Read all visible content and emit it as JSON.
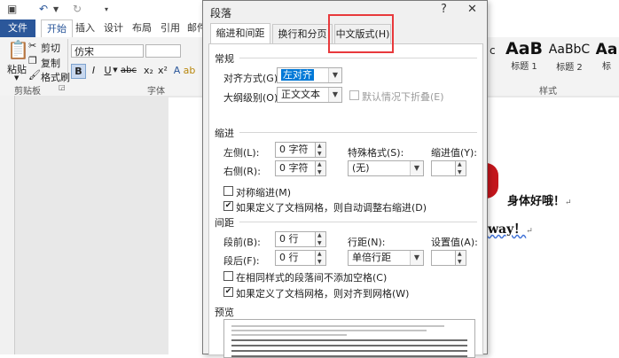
{
  "ribbon": {
    "tabs": [
      "文件",
      "开始",
      "插入",
      "设计",
      "布局",
      "引用",
      "邮件"
    ],
    "clipboard": {
      "paste": "粘贴",
      "cut": "剪切",
      "copy": "复制",
      "format_painter": "格式刷"
    },
    "font_name": "仿宋",
    "format_buttons": [
      "B",
      "I",
      "U",
      "abc",
      "x₂",
      "x²"
    ],
    "group_labels": {
      "clipboard": "剪贴板",
      "font": "字体",
      "styles": "样式"
    },
    "styles": [
      {
        "sample": "AaB",
        "name": "标题 1"
      },
      {
        "sample": "AaBbC",
        "name": "标题 2"
      },
      {
        "sample": "Aa",
        "name": "标"
      }
    ]
  },
  "document": {
    "line1": "身体好哦！",
    "line2": "way！",
    "paragraph_mark": "↵"
  },
  "dialog": {
    "title": "段落",
    "help_icon": "?",
    "close_icon": "✕",
    "tabs": [
      "缩进和间距(I)",
      "换行和分页(P)",
      "中文版式(H)"
    ],
    "general": {
      "heading": "常规",
      "alignment_label": "对齐方式(G):",
      "alignment_value": "左对齐",
      "outline_label": "大纲级别(O):",
      "outline_value": "正文文本",
      "collapse_label": "默认情况下折叠(E)"
    },
    "indent": {
      "heading": "缩进",
      "left_label": "左侧(L):",
      "left_value": "0 字符",
      "right_label": "右侧(R):",
      "right_value": "0 字符",
      "special_label": "特殊格式(S):",
      "special_value": "(无)",
      "value_label": "缩进值(Y):",
      "mirror_label": "对称缩进(M)",
      "auto_adjust_label": "如果定义了文档网格，则自动调整右缩进(D)"
    },
    "spacing": {
      "heading": "间距",
      "before_label": "段前(B):",
      "before_value": "0 行",
      "after_label": "段后(F):",
      "after_value": "0 行",
      "line_label": "行距(N):",
      "line_value": "单倍行距",
      "setting_label": "设置值(A):",
      "no_space_label": "在相同样式的段落间不添加空格(C)",
      "snap_grid_label": "如果定义了文档网格，则对齐到网格(W)"
    },
    "preview_heading": "预览"
  },
  "colors": {
    "word_blue": "#2b579a",
    "highlight": "#e8393c"
  }
}
